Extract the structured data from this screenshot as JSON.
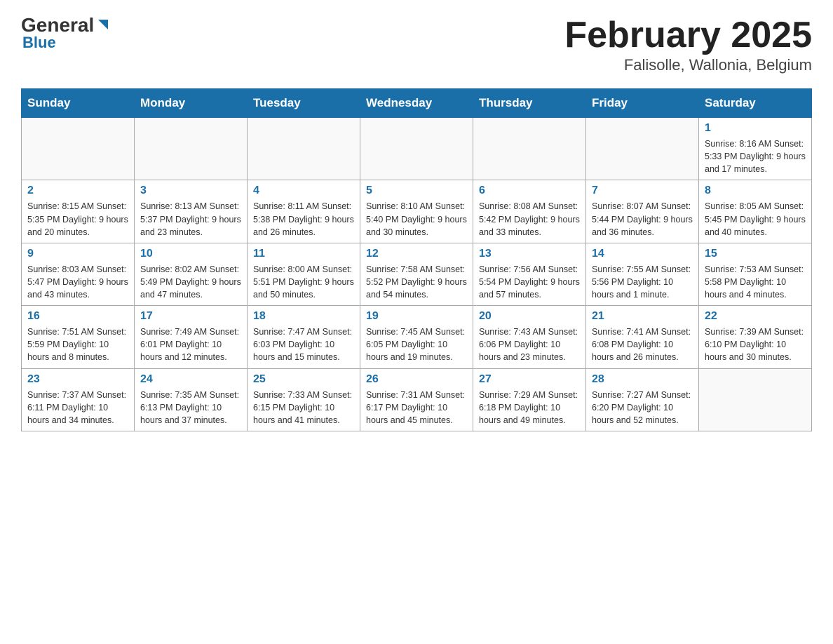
{
  "header": {
    "logo_general": "General",
    "logo_blue": "Blue",
    "title": "February 2025",
    "subtitle": "Falisolle, Wallonia, Belgium"
  },
  "days_of_week": [
    "Sunday",
    "Monday",
    "Tuesday",
    "Wednesday",
    "Thursday",
    "Friday",
    "Saturday"
  ],
  "weeks": [
    [
      {
        "day": null,
        "info": null
      },
      {
        "day": null,
        "info": null
      },
      {
        "day": null,
        "info": null
      },
      {
        "day": null,
        "info": null
      },
      {
        "day": null,
        "info": null
      },
      {
        "day": null,
        "info": null
      },
      {
        "day": "1",
        "info": "Sunrise: 8:16 AM\nSunset: 5:33 PM\nDaylight: 9 hours and 17 minutes."
      }
    ],
    [
      {
        "day": "2",
        "info": "Sunrise: 8:15 AM\nSunset: 5:35 PM\nDaylight: 9 hours and 20 minutes."
      },
      {
        "day": "3",
        "info": "Sunrise: 8:13 AM\nSunset: 5:37 PM\nDaylight: 9 hours and 23 minutes."
      },
      {
        "day": "4",
        "info": "Sunrise: 8:11 AM\nSunset: 5:38 PM\nDaylight: 9 hours and 26 minutes."
      },
      {
        "day": "5",
        "info": "Sunrise: 8:10 AM\nSunset: 5:40 PM\nDaylight: 9 hours and 30 minutes."
      },
      {
        "day": "6",
        "info": "Sunrise: 8:08 AM\nSunset: 5:42 PM\nDaylight: 9 hours and 33 minutes."
      },
      {
        "day": "7",
        "info": "Sunrise: 8:07 AM\nSunset: 5:44 PM\nDaylight: 9 hours and 36 minutes."
      },
      {
        "day": "8",
        "info": "Sunrise: 8:05 AM\nSunset: 5:45 PM\nDaylight: 9 hours and 40 minutes."
      }
    ],
    [
      {
        "day": "9",
        "info": "Sunrise: 8:03 AM\nSunset: 5:47 PM\nDaylight: 9 hours and 43 minutes."
      },
      {
        "day": "10",
        "info": "Sunrise: 8:02 AM\nSunset: 5:49 PM\nDaylight: 9 hours and 47 minutes."
      },
      {
        "day": "11",
        "info": "Sunrise: 8:00 AM\nSunset: 5:51 PM\nDaylight: 9 hours and 50 minutes."
      },
      {
        "day": "12",
        "info": "Sunrise: 7:58 AM\nSunset: 5:52 PM\nDaylight: 9 hours and 54 minutes."
      },
      {
        "day": "13",
        "info": "Sunrise: 7:56 AM\nSunset: 5:54 PM\nDaylight: 9 hours and 57 minutes."
      },
      {
        "day": "14",
        "info": "Sunrise: 7:55 AM\nSunset: 5:56 PM\nDaylight: 10 hours and 1 minute."
      },
      {
        "day": "15",
        "info": "Sunrise: 7:53 AM\nSunset: 5:58 PM\nDaylight: 10 hours and 4 minutes."
      }
    ],
    [
      {
        "day": "16",
        "info": "Sunrise: 7:51 AM\nSunset: 5:59 PM\nDaylight: 10 hours and 8 minutes."
      },
      {
        "day": "17",
        "info": "Sunrise: 7:49 AM\nSunset: 6:01 PM\nDaylight: 10 hours and 12 minutes."
      },
      {
        "day": "18",
        "info": "Sunrise: 7:47 AM\nSunset: 6:03 PM\nDaylight: 10 hours and 15 minutes."
      },
      {
        "day": "19",
        "info": "Sunrise: 7:45 AM\nSunset: 6:05 PM\nDaylight: 10 hours and 19 minutes."
      },
      {
        "day": "20",
        "info": "Sunrise: 7:43 AM\nSunset: 6:06 PM\nDaylight: 10 hours and 23 minutes."
      },
      {
        "day": "21",
        "info": "Sunrise: 7:41 AM\nSunset: 6:08 PM\nDaylight: 10 hours and 26 minutes."
      },
      {
        "day": "22",
        "info": "Sunrise: 7:39 AM\nSunset: 6:10 PM\nDaylight: 10 hours and 30 minutes."
      }
    ],
    [
      {
        "day": "23",
        "info": "Sunrise: 7:37 AM\nSunset: 6:11 PM\nDaylight: 10 hours and 34 minutes."
      },
      {
        "day": "24",
        "info": "Sunrise: 7:35 AM\nSunset: 6:13 PM\nDaylight: 10 hours and 37 minutes."
      },
      {
        "day": "25",
        "info": "Sunrise: 7:33 AM\nSunset: 6:15 PM\nDaylight: 10 hours and 41 minutes."
      },
      {
        "day": "26",
        "info": "Sunrise: 7:31 AM\nSunset: 6:17 PM\nDaylight: 10 hours and 45 minutes."
      },
      {
        "day": "27",
        "info": "Sunrise: 7:29 AM\nSunset: 6:18 PM\nDaylight: 10 hours and 49 minutes."
      },
      {
        "day": "28",
        "info": "Sunrise: 7:27 AM\nSunset: 6:20 PM\nDaylight: 10 hours and 52 minutes."
      },
      {
        "day": null,
        "info": null
      }
    ]
  ]
}
